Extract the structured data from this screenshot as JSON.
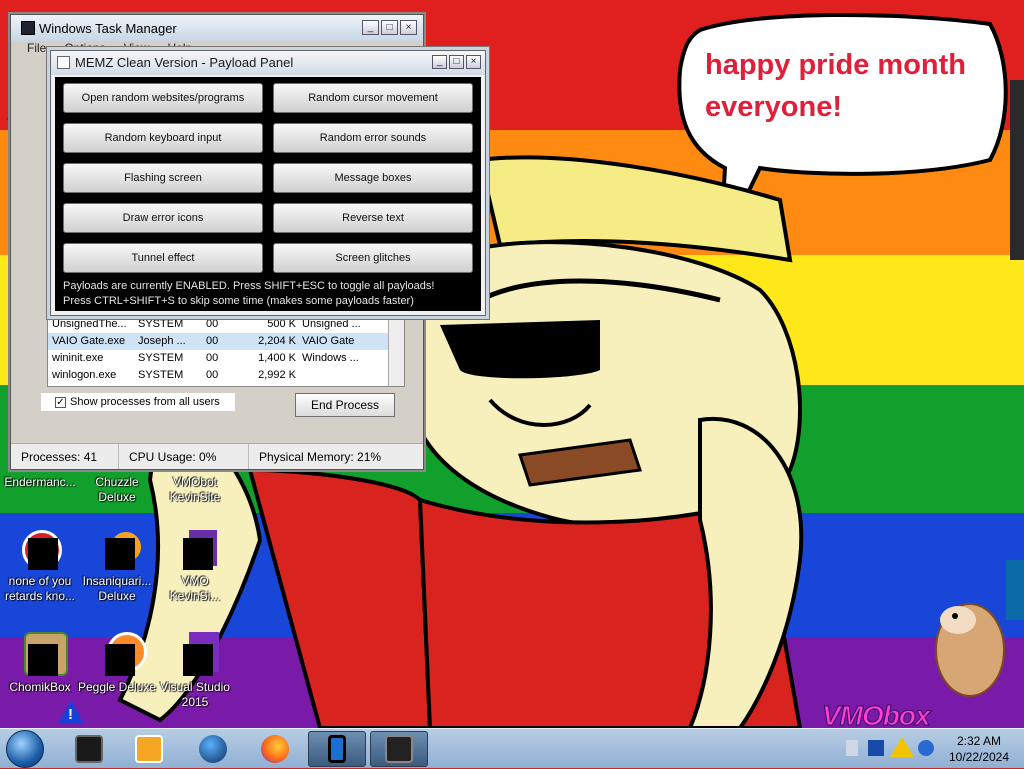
{
  "wallpaper": {
    "speech_line1": "happy pride month",
    "speech_line2": "everyone!",
    "logo": "VMObox",
    "colors": {
      "red": "#e01f1f",
      "orange": "#ff8a12",
      "yellow": "#ffe81a",
      "green": "#12a02c",
      "blue": "#1846d8",
      "purple": "#7a1aa8"
    }
  },
  "task_manager": {
    "title": "Windows Task Manager",
    "menu": [
      "File",
      "Options",
      "View",
      "Help"
    ],
    "processes": [
      {
        "name": "UnsignedThe...",
        "user": "SYSTEM",
        "cpu": "00",
        "mem": "500 K",
        "desc": "Unsigned ..."
      },
      {
        "name": "VAIO Gate.exe",
        "user": "Joseph ...",
        "cpu": "00",
        "mem": "2,204 K",
        "desc": "VAIO Gate"
      },
      {
        "name": "wininit.exe",
        "user": "SYSTEM",
        "cpu": "00",
        "mem": "1,400 K",
        "desc": "Windows ..."
      },
      {
        "name": "winlogon.exe",
        "user": "SYSTEM",
        "cpu": "00",
        "mem": "2,992 K",
        "desc": ""
      }
    ],
    "show_all_label": "Show processes from all users",
    "end_process_label": "End Process",
    "status_processes": "Processes: 41",
    "status_cpu": "CPU Usage: 0%",
    "status_memory": "Physical Memory: 21%"
  },
  "memz": {
    "title": "MEMZ Clean Version - Payload Panel",
    "buttons": [
      "Open random websites/programs",
      "Random cursor movement",
      "Random keyboard input",
      "Random error sounds",
      "Flashing screen",
      "Message boxes",
      "Draw error icons",
      "Reverse text",
      "Tunnel effect",
      "Screen glitches"
    ],
    "status_line1": "Payloads are currently ENABLED. Press SHIFT+ESC to toggle all payloads!",
    "status_line2": "Press CTRL+SHIFT+S to skip some time (makes some payloads faster)"
  },
  "desktop_icons": [
    {
      "label1": "Endermanc...",
      "label2": ""
    },
    {
      "label1": "Chuzzle",
      "label2": "Deluxe"
    },
    {
      "label1": "VMObot",
      "label2": "KevinSite"
    },
    {
      "label1": "none of you",
      "label2": "retards kno..."
    },
    {
      "label1": "Insaniquari...",
      "label2": "Deluxe"
    },
    {
      "label1": "VMO",
      "label2": "KevinSi..."
    },
    {
      "label1": "ChomikBox",
      "label2": ""
    },
    {
      "label1": "Peggle Deluxe",
      "label2": ""
    },
    {
      "label1": "Visual Studio",
      "label2": "2015"
    }
  ],
  "taskbar": {
    "time": "2:32 AM",
    "date": "10/22/2024"
  },
  "icons": [
    "start-orb-icon",
    "windows-icon",
    "media-player-icon",
    "globe-icon",
    "firefox-icon",
    "phone-icon",
    "task-manager-icon",
    "warning-icon",
    "error-icon"
  ]
}
